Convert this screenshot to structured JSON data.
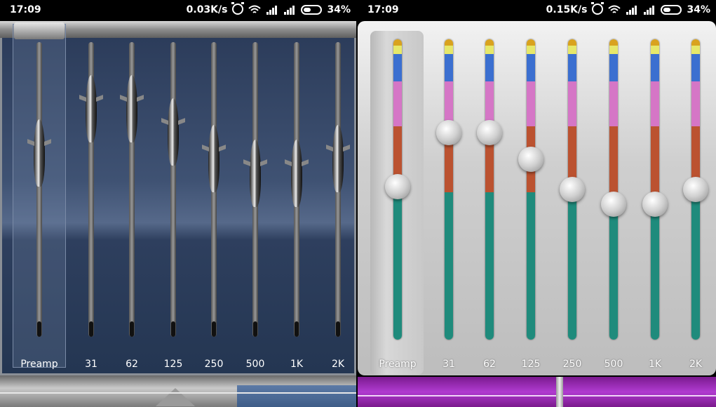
{
  "status_left": {
    "time": "17:09",
    "speed": "0.03K/s",
    "battery": "34%"
  },
  "status_right": {
    "time": "17:09",
    "speed": "0.15K/s",
    "battery": "34%"
  },
  "bands": [
    "Preamp",
    "31",
    "62",
    "125",
    "250",
    "500",
    "1K",
    "2K"
  ],
  "left_levels": [
    0.62,
    0.77,
    0.77,
    0.69,
    0.6,
    0.55,
    0.55,
    0.6
  ],
  "right_levels": [
    0.51,
    0.69,
    0.69,
    0.6,
    0.5,
    0.45,
    0.45,
    0.5
  ],
  "colors": {
    "teal": "#1f8b7c",
    "orange": "#bb5230",
    "pink": "#d576c6",
    "blue": "#3b6fd0",
    "yellow": "#e6e86a",
    "gold": "#d9a21e",
    "left_bg": "#3f5273",
    "right_accent": "#b03bd0"
  },
  "icons": [
    "alarm-icon",
    "wifi-icon",
    "signal-icon",
    "signal-icon-2",
    "battery-icon"
  ]
}
